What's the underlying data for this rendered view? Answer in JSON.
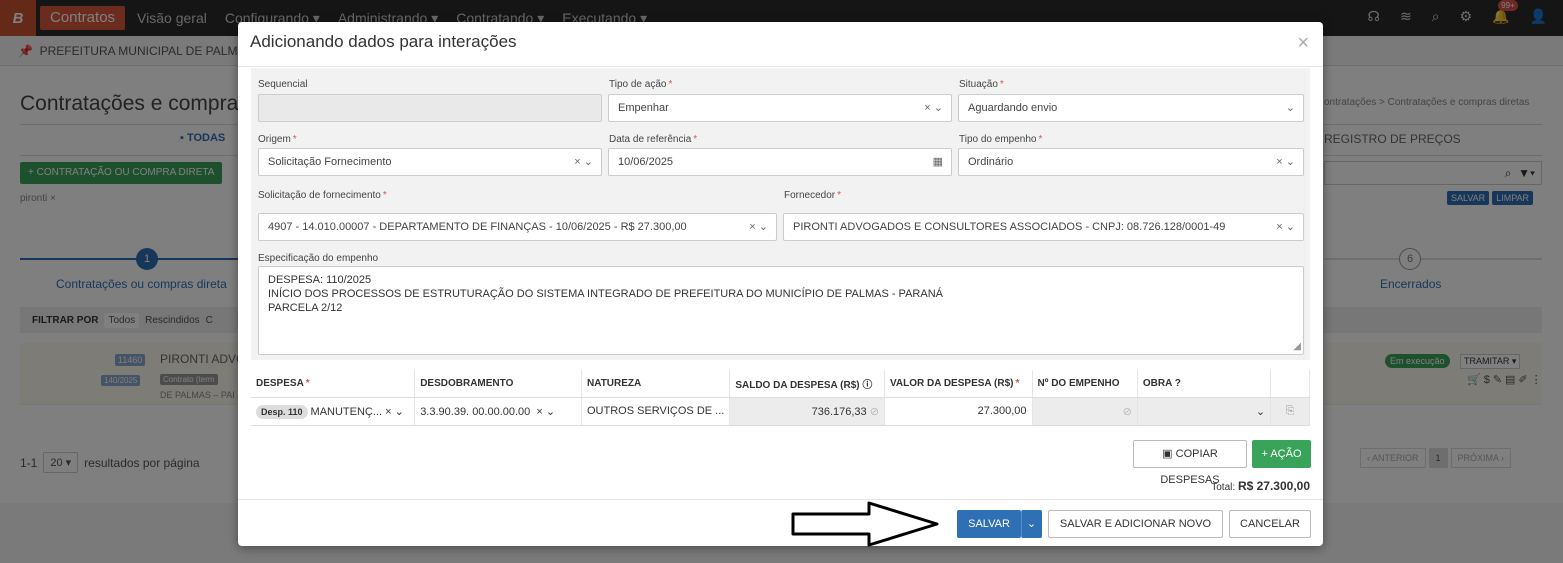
{
  "topbar": {
    "logo": "B",
    "app_name": "Contratos",
    "nav": [
      "Visão geral",
      "Configurando",
      "Administrando",
      "Contratando",
      "Executando"
    ],
    "notif_badge": "99+"
  },
  "crumb": {
    "org": "PREFEITURA MUNICIPAL DE PALM"
  },
  "page": {
    "title": "Contratações e compras",
    "breadcrumb_right": "ontratações > Contratações e compras diretas",
    "tab_todas": "TODAS",
    "tab_registro": "REGISTRO DE PREÇOS",
    "new_button": "+ CONTRATAÇÃO OU COMPRA DIRETA",
    "filter_tag": "pironti ×",
    "save_filter": "SALVAR",
    "clear_filter": "LIMPAR",
    "step1_num": "1",
    "step1_label": "Contratações ou compras direta",
    "step6_num": "6",
    "step6_label": "Encerrados",
    "filter_label": "FILTRAR POR",
    "filter_all": "Todos",
    "filter_rescinded": "Rescindidos",
    "filter_c": "C",
    "row_num": "11460",
    "row_name": "PIRONTI ADVC",
    "row_num2": "140/2025",
    "row_contract": "Contrato (term",
    "row_city": "DE PALMAS – PAI",
    "row_status": "Em execução",
    "row_tramitar": "TRAMITAR",
    "pager_range": "1-1",
    "pager_size": "20",
    "pager_text": "resultados por página",
    "pager_prev": "‹ ANTERIOR",
    "pager_cur": "1",
    "pager_next": "PRÓXIMA ›"
  },
  "modal": {
    "title": "Adicionando dados para interações",
    "close": "×",
    "sequencial": {
      "label": "Sequencial",
      "value": ""
    },
    "tipo_acao": {
      "label": "Tipo de ação",
      "value": "Empenhar"
    },
    "situacao": {
      "label": "Situação",
      "value": "Aguardando envio"
    },
    "origem": {
      "label": "Origem",
      "value": "Solicitação Fornecimento"
    },
    "data_ref": {
      "label": "Data de referência",
      "value": "10/06/2025"
    },
    "tipo_empenho": {
      "label": "Tipo do empenho",
      "value": "Ordinário"
    },
    "solicitacao": {
      "label": "Solicitação de fornecimento",
      "value": "4907 - 14.010.00007 - DEPARTAMENTO DE FINANÇAS - 10/06/2025 - R$ 27.300,00"
    },
    "fornecedor": {
      "label": "Fornecedor",
      "value": "PIRONTI ADVOGADOS E CONSULTORES ASSOCIADOS - CNPJ: 08.726.128/0001-49"
    },
    "especificacao": {
      "label": "Especificação do empenho",
      "lines": [
        "DESPESA: 110/2025",
        "INÍCIO DOS PROCESSOS DE ESTRUTURAÇÃO DO SISTEMA INTEGRADO DE PREFEITURA DO MUNICÍPIO DE PALMAS - PARANÁ",
        "PARCELA 2/12"
      ]
    },
    "table": {
      "headers": [
        "DESPESA",
        "DESDOBRAMENTO",
        "NATUREZA",
        "SALDO DA DESPESA (R$)",
        "VALOR DA DESPESA (R$)",
        "Nº DO EMPENHO",
        "OBRA"
      ],
      "row": {
        "despesa_chip": "Desp. 110",
        "despesa": "MANUTENÇ...",
        "desdobramento_a": "3.3.90.39.",
        "desdobramento_b": "00.00.00.00",
        "natureza": "OUTROS SERVIÇOS DE ...",
        "saldo": "736.176,33",
        "valor": "27.300,00",
        "empenho": "",
        "obra": ""
      }
    },
    "copy_button": "COPIAR DESPESAS",
    "action_button": "+ AÇÃO",
    "total_label": "Total:",
    "total_value": "R$ 27.300,00",
    "save_button": "SALVAR",
    "save_new_button": "SALVAR E ADICIONAR NOVO",
    "cancel_button": "CANCELAR"
  }
}
